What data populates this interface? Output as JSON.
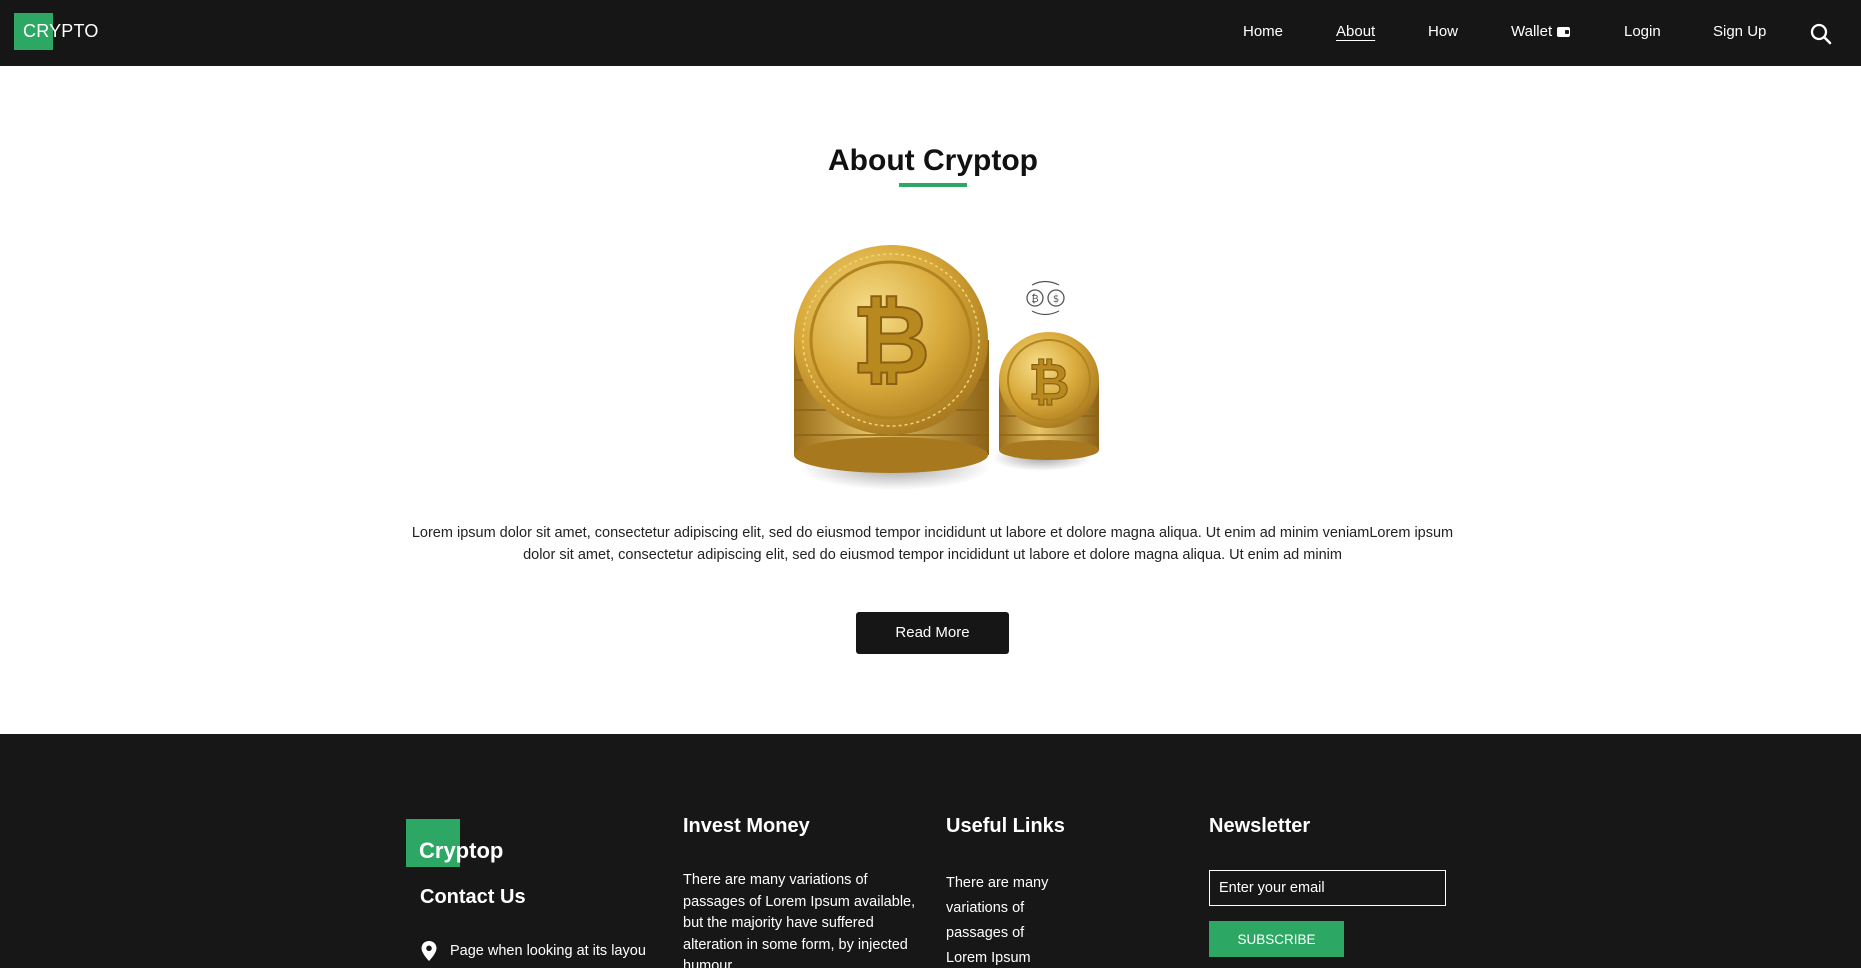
{
  "nav": {
    "brand": "CRYPTO",
    "links": [
      "Home",
      "About",
      "How",
      "Wallet",
      "Login",
      "Sign Up"
    ],
    "active": "About"
  },
  "about": {
    "title": "About Cryptop",
    "body": "Lorem ipsum dolor sit amet, consectetur adipiscing elit, sed do eiusmod tempor incididunt ut labore et dolore magna aliqua. Ut enim ad minim veniamLorem ipsum dolor sit amet, consectetur adipiscing elit, sed do eiusmod tempor incididunt ut labore et dolore magna aliqua. Ut enim ad minim",
    "button": "Read More"
  },
  "footer": {
    "logo": "Cryptop",
    "contact_title": "Contact Us",
    "contact_address": "Page when looking at its layou",
    "invest_title": "Invest Money",
    "invest_text": "There are many variations of passages of Lorem Ipsum available, but the majority have suffered alteration in some form, by injected humour",
    "links_title": "Useful Links",
    "links_text": "There are many variations of passages of Lorem Ipsum",
    "newsletter_title": "Newsletter",
    "email_placeholder": "Enter your email",
    "subscribe_label": "SUBSCRIBE"
  },
  "colors": {
    "accent": "#2da864",
    "dark": "#161617",
    "coin": "#d8a93a"
  },
  "icons": {
    "search": "search-icon",
    "wallet": "wallet-icon",
    "exchange": "currency-exchange-icon",
    "location": "location-pin-icon",
    "coin": "bitcoin-coin-icon"
  }
}
